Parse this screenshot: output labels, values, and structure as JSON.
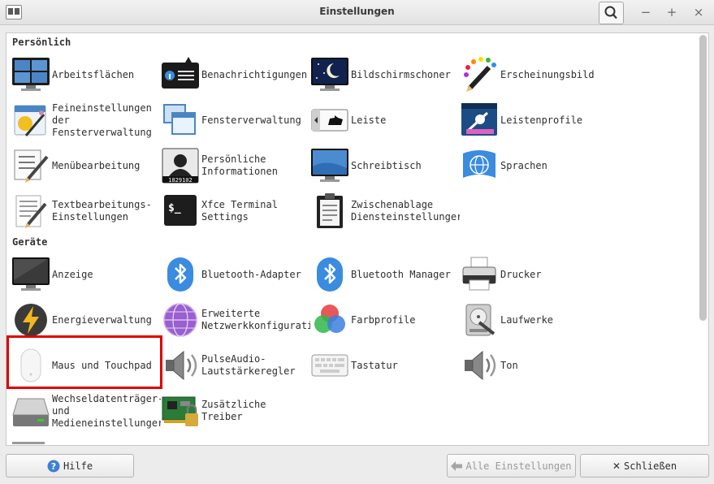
{
  "window": {
    "title": "Einstellungen"
  },
  "sections": [
    {
      "title": "Persönlich",
      "items": [
        {
          "label": "Arbeitsflächen",
          "icon": "workspaces-icon"
        },
        {
          "label": "Benachrichtigungen",
          "icon": "notifications-icon"
        },
        {
          "label": "Bildschirmschoner",
          "icon": "screensaver-icon"
        },
        {
          "label": "Erscheinungsbild",
          "icon": "appearance-icon"
        },
        {
          "label": "Feineinstellungen\nder\nFensterverwaltung",
          "icon": "wm-tweaks-icon"
        },
        {
          "label": "Fensterverwaltung",
          "icon": "window-manager-icon"
        },
        {
          "label": "Leiste",
          "icon": "panel-icon"
        },
        {
          "label": "Leistenprofile",
          "icon": "panel-profiles-icon"
        },
        {
          "label": "Menübearbeitung",
          "icon": "menu-editor-icon"
        },
        {
          "label": "Persönliche\nInformationen",
          "icon": "user-info-icon"
        },
        {
          "label": "Schreibtisch",
          "icon": "desktop-icon"
        },
        {
          "label": "Sprachen",
          "icon": "languages-icon"
        },
        {
          "label": "Textbearbeitungs-\nEinstellungen",
          "icon": "text-editor-icon"
        },
        {
          "label": "Xfce Terminal\nSettings",
          "icon": "terminal-icon"
        },
        {
          "label": "Zwischenablage\nDiensteinstellunger",
          "icon": "clipboard-icon"
        }
      ]
    },
    {
      "title": "Geräte",
      "items": [
        {
          "label": "Anzeige",
          "icon": "display-icon"
        },
        {
          "label": "Bluetooth-Adapter",
          "icon": "bluetooth-icon"
        },
        {
          "label": "Bluetooth Manager",
          "icon": "bluetooth-icon"
        },
        {
          "label": "Drucker",
          "icon": "printer-icon"
        },
        {
          "label": "Energieverwaltung",
          "icon": "power-icon"
        },
        {
          "label": "Erweiterte\nNetzwerkkonfigurati",
          "icon": "network-icon"
        },
        {
          "label": "Farbprofile",
          "icon": "color-profiles-icon"
        },
        {
          "label": "Laufwerke",
          "icon": "drives-icon"
        },
        {
          "label": "Maus und Touchpad",
          "icon": "mouse-icon"
        },
        {
          "label": "PulseAudio-\nLautstärkeregler",
          "icon": "speaker-icon"
        },
        {
          "label": "Tastatur",
          "icon": "keyboard-icon"
        },
        {
          "label": "Ton",
          "icon": "speaker-icon"
        },
        {
          "label": "Wechseldatenträger-\nund\nMedieneinstellunger",
          "icon": "removable-drive-icon"
        },
        {
          "label": "Zusätzliche\nTreiber",
          "icon": "drivers-icon"
        }
      ]
    }
  ],
  "footer": {
    "help": "Hilfe",
    "all_settings": "Alle Einstellungen",
    "close": "Schließen"
  },
  "colors": {
    "highlight": "#e00000"
  }
}
